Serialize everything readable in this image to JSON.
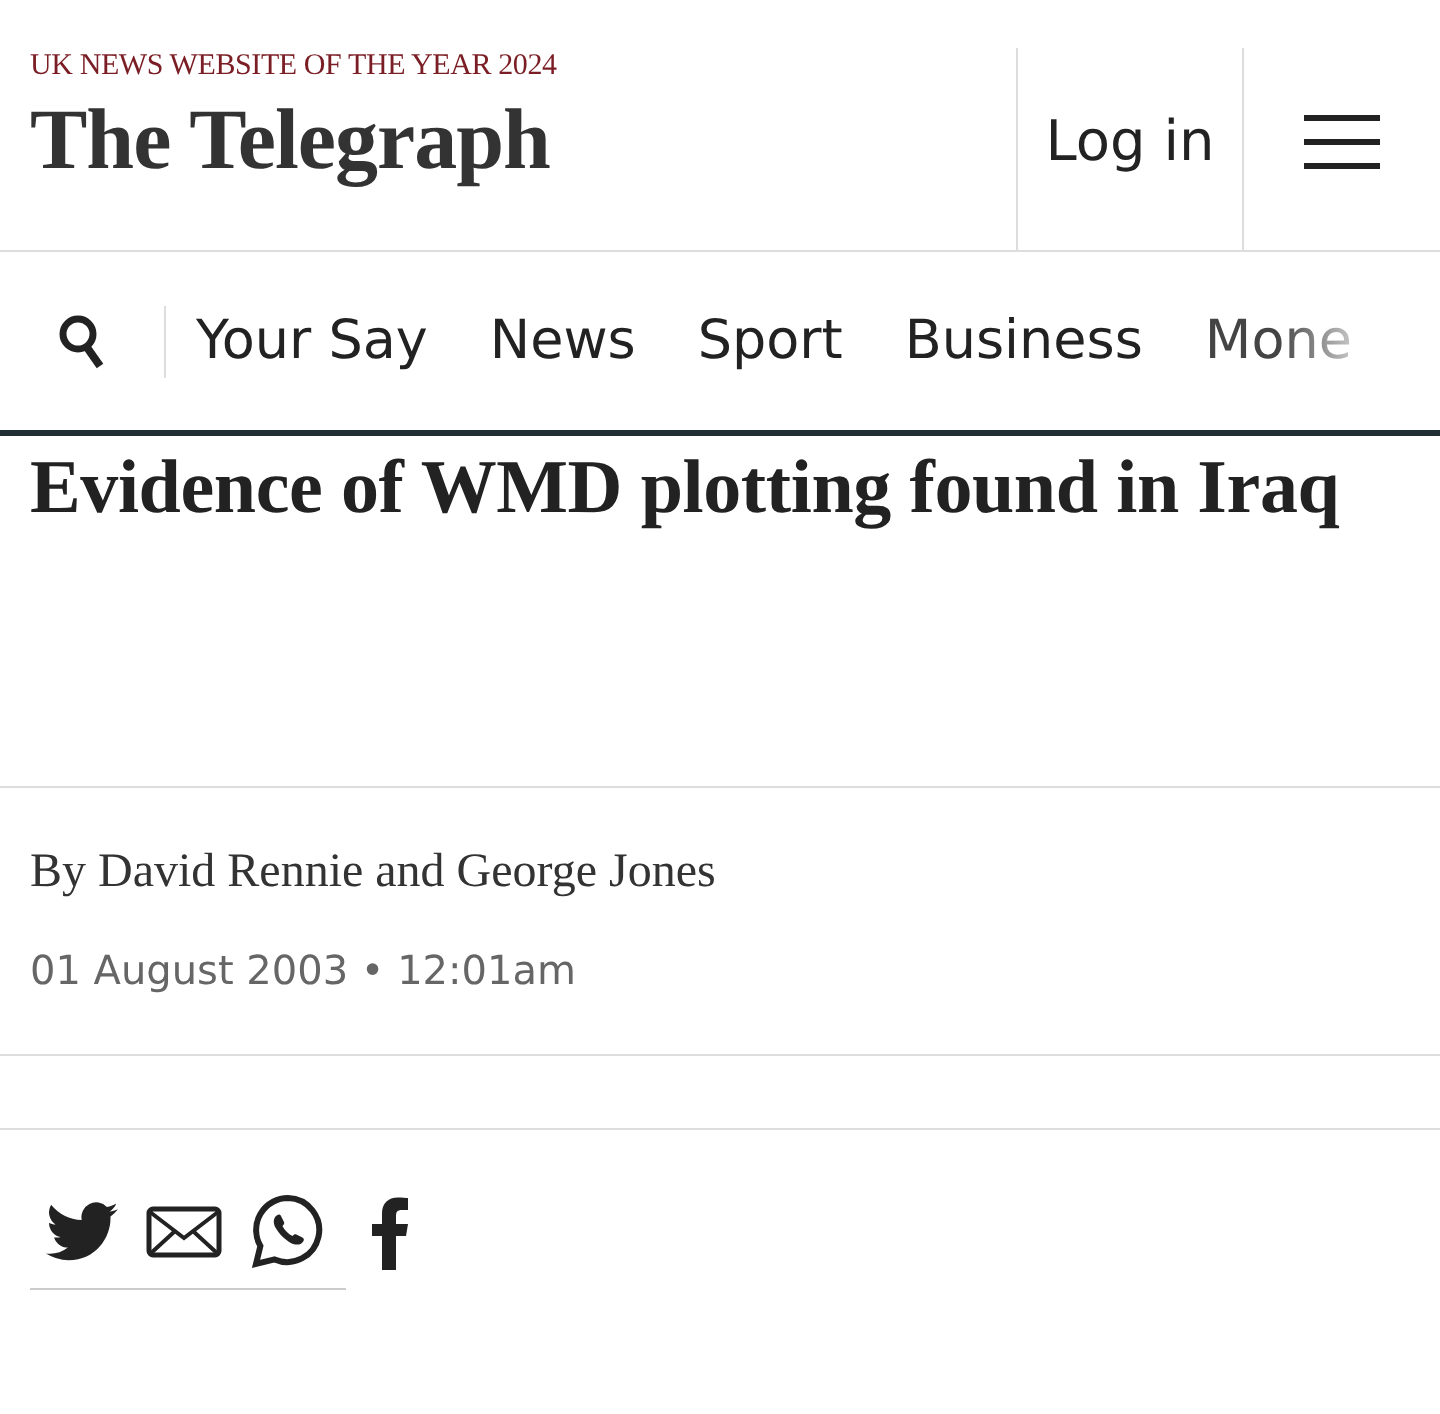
{
  "header": {
    "award": "UK NEWS WEBSITE OF THE YEAR 2024",
    "logo": "The Telegraph",
    "login": "Log in"
  },
  "nav": {
    "items": [
      {
        "label": "Your Say"
      },
      {
        "label": "News"
      },
      {
        "label": "Sport"
      },
      {
        "label": "Business"
      },
      {
        "label": "Mone"
      }
    ]
  },
  "article": {
    "headline": "Evidence of WMD plotting found in Iraq",
    "byline": "By David Rennie and George Jones",
    "date": "01 August 2003",
    "separator": "•",
    "time": "12:01am"
  },
  "share_buttons": [
    {
      "kind": "twitter"
    },
    {
      "kind": "email"
    },
    {
      "kind": "whatsapp"
    },
    {
      "kind": "facebook"
    }
  ]
}
